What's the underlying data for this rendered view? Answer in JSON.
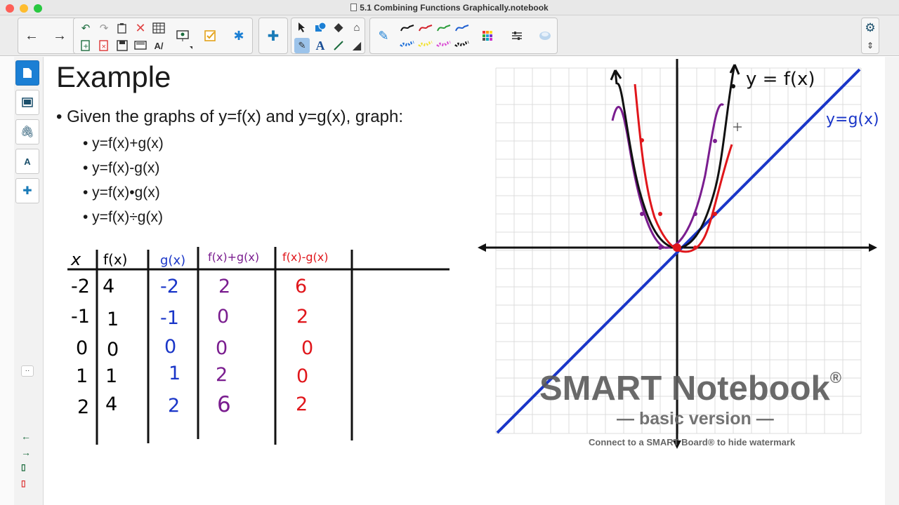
{
  "window": {
    "title": "5.1 Combining Functions Graphically.notebook",
    "lights": [
      "#fe5f57",
      "#febc2e",
      "#28c840"
    ]
  },
  "toolbar": {
    "icons": [
      "back-arrow-icon",
      "forward-arrow-icon",
      "undo-icon",
      "redo-icon",
      "paste-icon",
      "delete-icon",
      "table-icon",
      "add-page-icon",
      "delete-page-icon",
      "save-icon",
      "screen-shade-icon",
      "document-camera-icon",
      "activity-builder-icon",
      "add-ons-icon",
      "select-icon",
      "shapes-icon",
      "fill-icon",
      "eraser-fill-icon",
      "pens-icon",
      "text-icon",
      "line-icon",
      "eraser-icon",
      "pen-icon",
      "fill-color-icon",
      "properties-icon",
      "magic-pen-icon",
      "settings-icon",
      "collapse-toolbar-icon"
    ],
    "pen_colors": [
      "#111111",
      "#d3202a",
      "#2a9d3a",
      "#1f5fd0",
      "#1d6fd8",
      "#f2e233",
      "#d94bd3",
      "#111111"
    ]
  },
  "sidebar": {
    "tabs": [
      "page-sorter-icon",
      "gallery-icon",
      "attachments-icon",
      "properties-icon",
      "add-ons-icon"
    ],
    "collapse_label": "··"
  },
  "slide": {
    "heading": "Example",
    "bullet": "• Given the graphs of y=f(x) and y=g(x), graph:",
    "sub_bullets": [
      "• y=f(x)+g(x)",
      "• y=f(x)-g(x)",
      "• y=f(x)•g(x)",
      "• y=f(x)÷g(x)"
    ],
    "table": {
      "headers": [
        "x",
        "f(x)",
        "g(x)",
        "f(x)+g(x)",
        "f(x)-g(x)"
      ],
      "header_colors": [
        "#111111",
        "#111111",
        "#1a36c8",
        "#7a1d8f",
        "#e0161b"
      ],
      "rows": [
        [
          "-2",
          "4",
          "-2",
          "2",
          "6"
        ],
        [
          "-1",
          "1",
          "-1",
          "0",
          "2"
        ],
        [
          "0",
          "0",
          "0",
          "0",
          "0"
        ],
        [
          "1",
          "1",
          "1",
          "2",
          "0"
        ],
        [
          "2",
          "4",
          "2",
          "6",
          "2"
        ]
      ]
    },
    "graph": {
      "label_f": "y = f(x)",
      "label_g": "y=g(x)",
      "colors": {
        "f": "#111111",
        "g": "#1a36c8",
        "sum": "#7a1d8f",
        "diff": "#e0161b"
      }
    }
  },
  "watermark": {
    "title": "SMART Notebook",
    "reg": "®",
    "subtitle": "— basic version —",
    "note": "Connect to a SMART Board® to hide watermark"
  }
}
